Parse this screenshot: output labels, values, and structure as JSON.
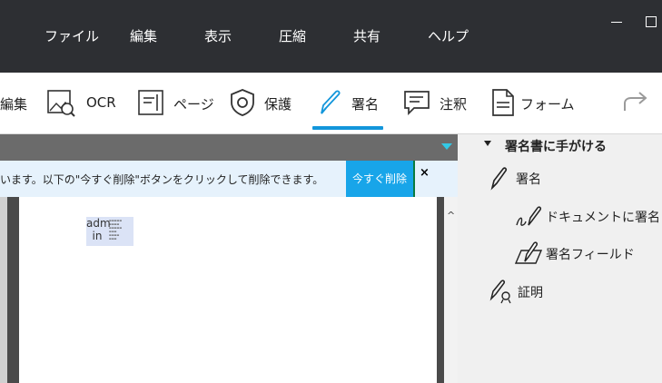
{
  "menubar": {
    "items": [
      "ファイル",
      "編集",
      "表示",
      "圧縮",
      "共有",
      "ヘルプ"
    ],
    "window_controls": [
      "minimize-icon",
      "maximize-icon"
    ]
  },
  "toolbar": {
    "tools": [
      {
        "label": "編集",
        "icon": "edit-icon"
      },
      {
        "label": "OCR",
        "icon": "ocr-icon"
      },
      {
        "label": "ページ",
        "icon": "page-icon"
      },
      {
        "label": "保護",
        "icon": "shield-icon"
      },
      {
        "label": "署名",
        "icon": "pen-icon",
        "active": true
      },
      {
        "label": "注釈",
        "icon": "comment-icon"
      },
      {
        "label": "フォーム",
        "icon": "form-icon"
      }
    ],
    "redo_icon": "redo-arrow-icon",
    "accent_color": "#1296db"
  },
  "notice": {
    "message": "います。以下の\"今すぐ削除\"ボタンをクリックして削除できます。",
    "action_label": "今すぐ削除",
    "close_label": "×"
  },
  "document": {
    "stamp_text": "adm in"
  },
  "panel": {
    "section_title": "署名書に手がける",
    "items": [
      {
        "label": "署名",
        "icon": "signature-pen-icon"
      },
      {
        "label": "ドキュメントに署名",
        "icon": "sign-document-icon"
      },
      {
        "label": "署名フィールド",
        "icon": "signature-field-icon"
      },
      {
        "label": "証明",
        "icon": "certify-icon"
      }
    ]
  }
}
